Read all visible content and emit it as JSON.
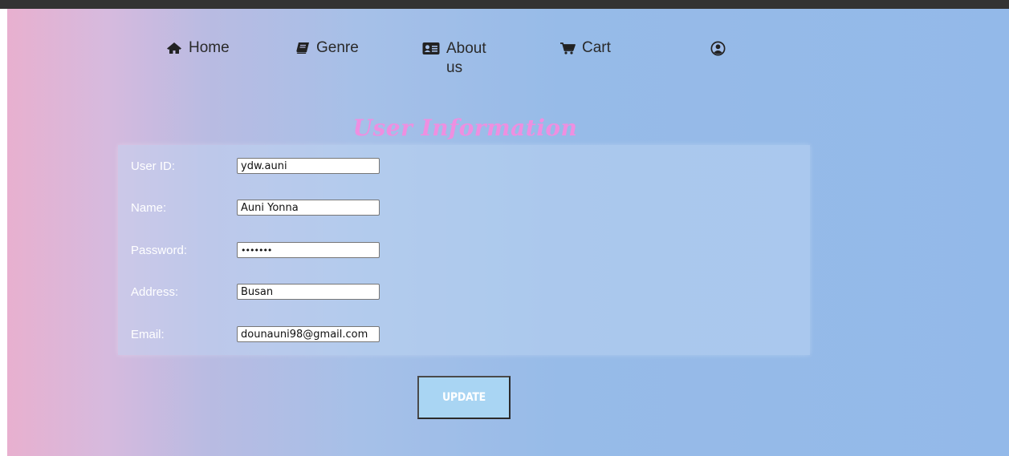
{
  "nav": {
    "home": {
      "label": "Home",
      "icon": "home-icon"
    },
    "genre": {
      "label": "Genre",
      "icon": "book-icon"
    },
    "about": {
      "label": "About us",
      "icon": "address-card-icon"
    },
    "cart": {
      "label": "Cart",
      "icon": "cart-icon"
    },
    "profile": {
      "icon": "user-circle-icon"
    }
  },
  "page_title": "User Information",
  "form": {
    "user_id": {
      "label": "User ID:",
      "value": "ydw.auni"
    },
    "name": {
      "label": "Name:",
      "value": "Auni Yonna"
    },
    "password": {
      "label": "Password:",
      "value": "•••••••"
    },
    "address": {
      "label": "Address:",
      "value": "Busan"
    },
    "email": {
      "label": "Email:",
      "value": "dounauni98@gmail.com"
    }
  },
  "update_button": "UPDATE",
  "colors": {
    "title_pink": "#ee8fe0",
    "button_blue": "#a9d5f3",
    "gradient_left": "#e8b0cf",
    "gradient_right": "#93b9e9"
  }
}
